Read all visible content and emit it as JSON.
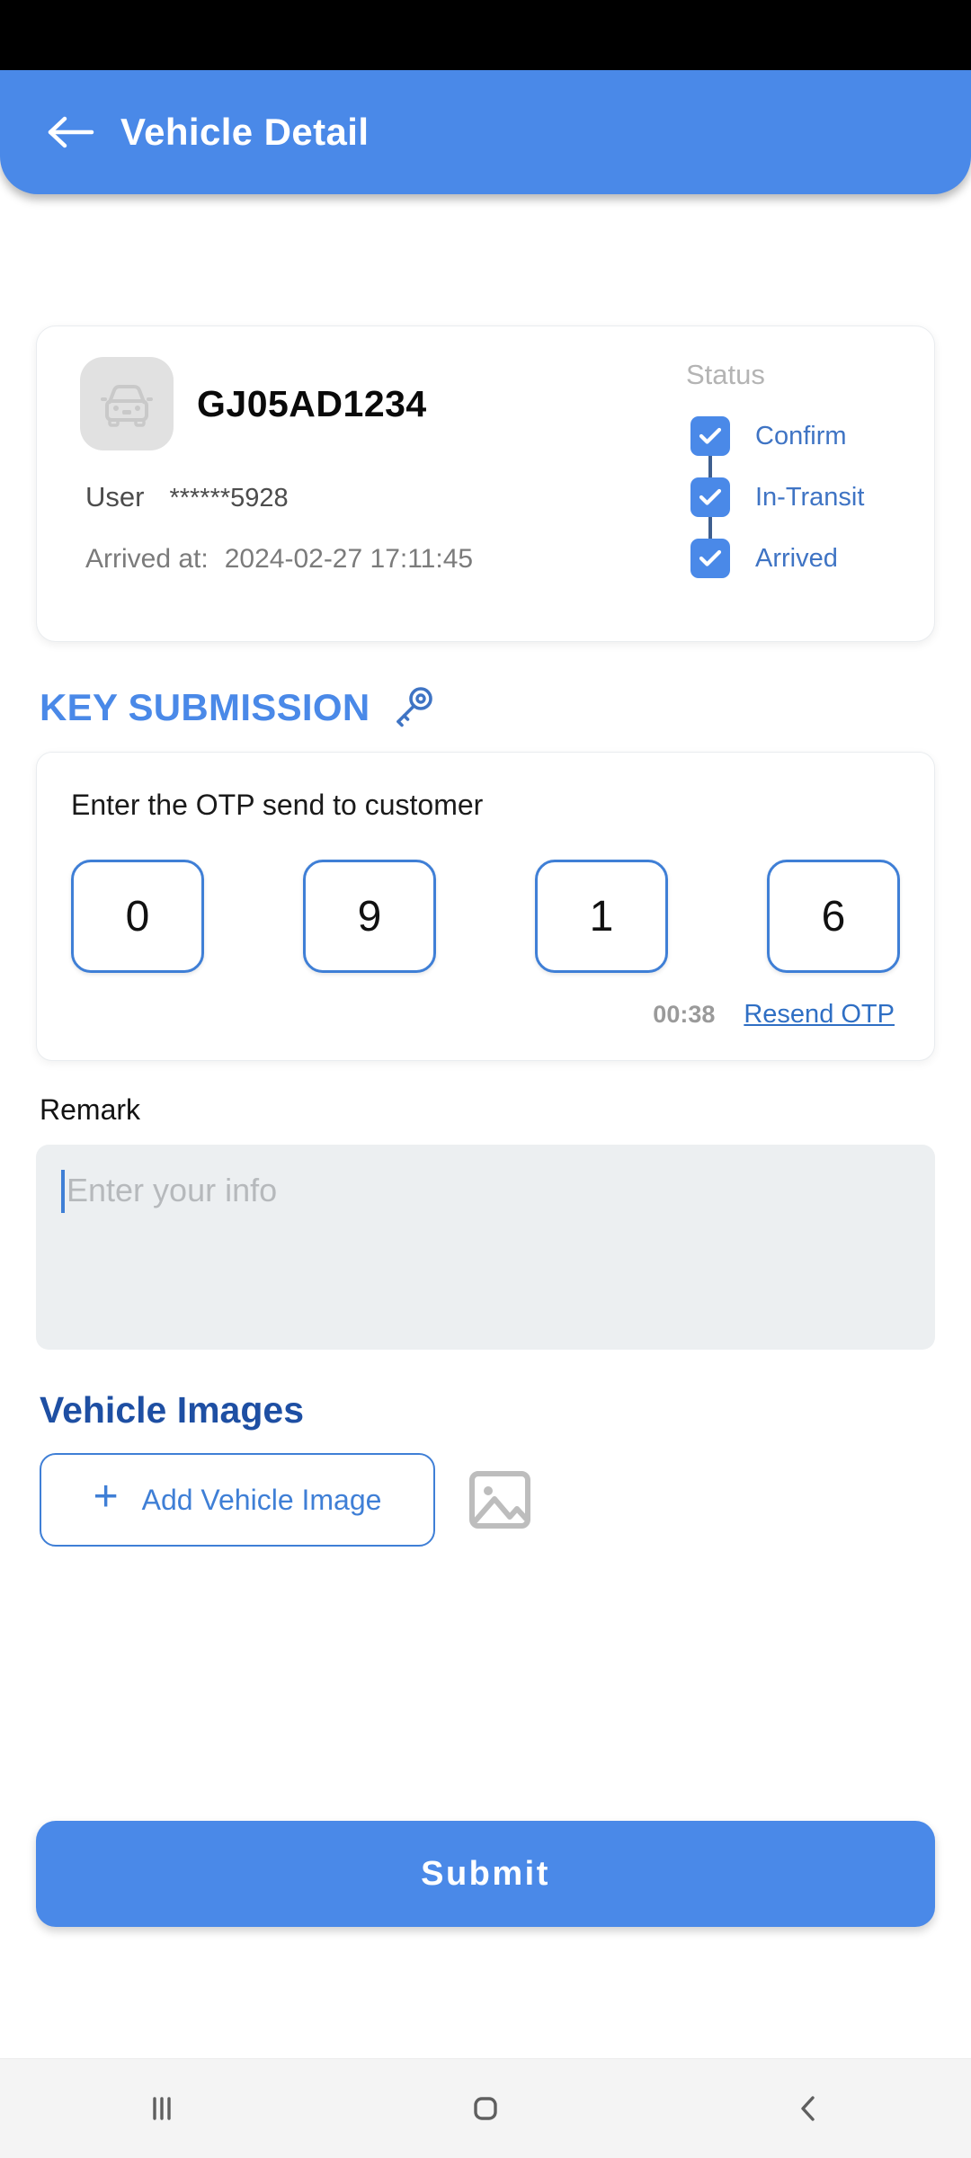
{
  "appbar": {
    "title": "Vehicle Detail",
    "back_icon": "arrow-left-icon"
  },
  "vehicle_card": {
    "car_icon": "car-front-icon",
    "plate": "GJ05AD1234",
    "user_label": "User",
    "user_value": "******5928",
    "arrived_label": "Arrived at:",
    "arrived_value": "2024-02-27 17:11:45",
    "status_title": "Status",
    "statuses": [
      {
        "label": "Confirm",
        "checked": true
      },
      {
        "label": "In-Transit",
        "checked": true
      },
      {
        "label": "Arrived",
        "checked": true
      }
    ]
  },
  "key_submission": {
    "heading": "KEY SUBMISSION",
    "key_icon": "key-icon",
    "otp_hint": "Enter the OTP send to customer",
    "otp_digits": [
      "0",
      "9",
      "1",
      "6"
    ],
    "timer": "00:38",
    "resend_label": "Resend OTP"
  },
  "remark": {
    "label": "Remark",
    "placeholder": "Enter your info",
    "value": ""
  },
  "vehicle_images": {
    "title": "Vehicle Images",
    "add_button_label": "Add Vehicle Image",
    "plus_icon": "plus-icon",
    "placeholder_icon": "image-placeholder-icon"
  },
  "footer": {
    "submit_label": "Submit"
  },
  "navbar": {
    "recents_icon": "recents-icon",
    "home_icon": "home-icon",
    "back_icon": "back-chevron-icon"
  },
  "colors": {
    "primary": "#4a89e8",
    "link": "#3f7fd6",
    "heading_dark_blue": "#1e4fa3",
    "muted": "#9a9a9a"
  }
}
